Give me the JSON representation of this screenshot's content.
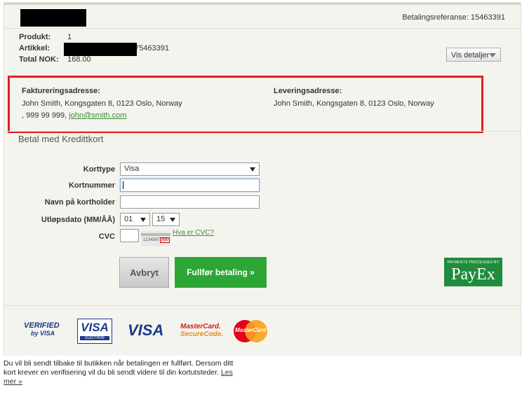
{
  "header": {
    "reference_label": "Betalingsreferanse:",
    "reference_value": "15463391"
  },
  "summary": {
    "product_label": "Produkt:",
    "product_value": "1",
    "article_label": "Artikkel:",
    "article_value": "75463391",
    "total_label": "Total NOK:",
    "total_value": "168.00",
    "details_button": "Vis detaljer"
  },
  "billing": {
    "heading": "Faktureringsadresse:",
    "address": "John Smith, Kongsgaten 8, 0123 Oslo, Norway",
    "phone": ", 999 99 999,",
    "email": "john@smith.com"
  },
  "shipping": {
    "heading": "Leveringsadresse:",
    "address": "John Smith, Kongsgaten 8, 0123 Oslo, Norway"
  },
  "section": {
    "title": "Betal med Kredittkort"
  },
  "form": {
    "card_type_label": "Korttype",
    "card_type_value": "Visa",
    "card_number_label": "Kortnummer",
    "card_number_value": "",
    "holder_label": "Navn på kortholder",
    "holder_value": "",
    "expiry_label": "Utløpsdato (MM/ÅÅ)",
    "expiry_month": "01",
    "expiry_year": "15",
    "cvc_label": "CVC",
    "cvc_value": "",
    "cvc_help": "Hva er CVC?",
    "cvc_card_digits": "1234567",
    "cvc_card_code": "890"
  },
  "buttons": {
    "cancel": "Avbryt",
    "pay": "Fullfør betaling »"
  },
  "payex": {
    "tagline": "PAYMENTS PROCESSED BY",
    "name": "PayEx"
  },
  "logos": {
    "verified_by_visa_1": "VERIFIED",
    "verified_by_visa_2": "by VISA",
    "visa_electron": "VISA",
    "visa_electron_sub": "ELECTRON",
    "visa": "VISA",
    "mc_securecode_1": "MasterCard.",
    "mc_securecode_2": "SecureCode.",
    "mastercard": "MasterCard"
  },
  "footer": {
    "text": "Du vil bli sendt tilbake til butikken når betalingen er fullført. Dersom ditt kort krever en verifisering vil du bli sendt videre til din kortutsteder.",
    "link": "Les mer »"
  },
  "colors": {
    "accent_green": "#2ea636",
    "highlight_red": "#e31e24",
    "payex_green": "#1f8d3c"
  }
}
